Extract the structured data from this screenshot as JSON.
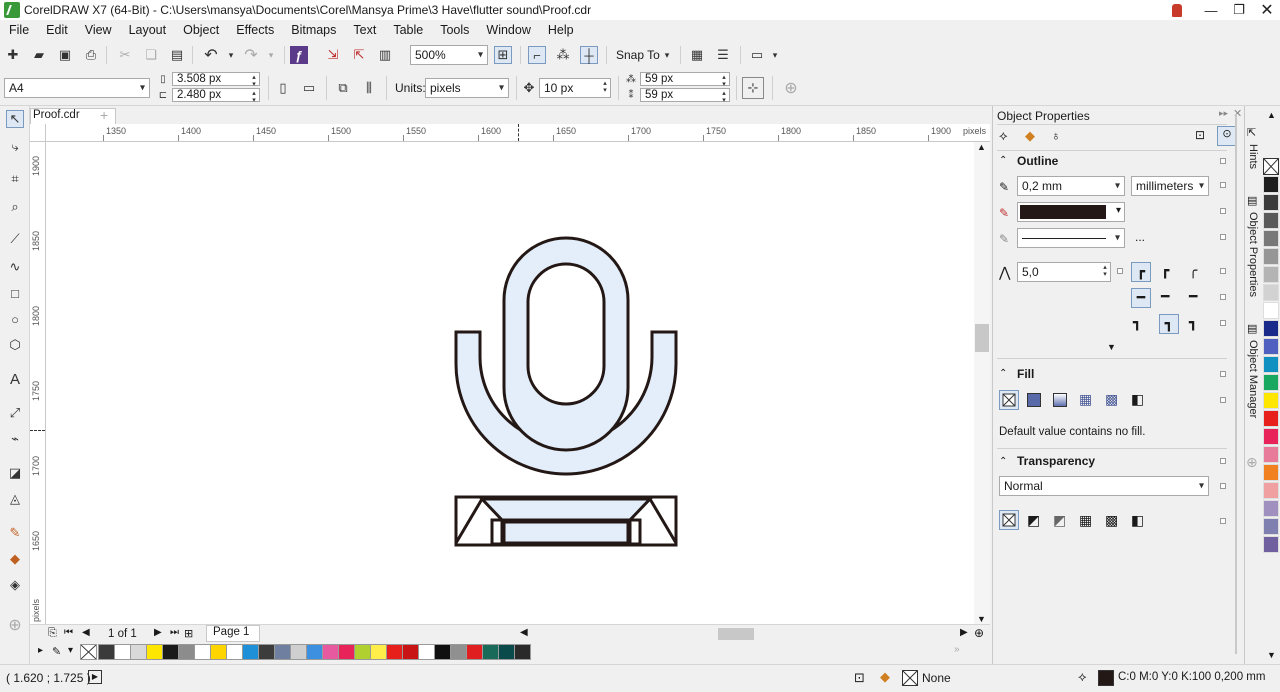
{
  "window": {
    "title": "CorelDRAW X7 (64-Bit) - C:\\Users\\mansya\\Documents\\Corel\\Mansya Prime\\3 Have\\flutter sound\\Proof.cdr"
  },
  "menu": [
    "File",
    "Edit",
    "View",
    "Layout",
    "Object",
    "Effects",
    "Bitmaps",
    "Text",
    "Table",
    "Tools",
    "Window",
    "Help"
  ],
  "toolbar": {
    "zoom": "500%",
    "snap_to": "Snap To"
  },
  "property_bar": {
    "page_size": "A4",
    "width": "3.508 px",
    "height": "2.480 px",
    "units_label": "Units:",
    "units": "pixels",
    "nudge": "10 px",
    "dup_x": "59 px",
    "dup_y": "59 px"
  },
  "document": {
    "tab": "Proof.cdr"
  },
  "rulers": {
    "h_labels": [
      "1350",
      "1400",
      "1450",
      "1500",
      "1550",
      "1600",
      "1650",
      "1700",
      "1750",
      "1800",
      "1850",
      "1900"
    ],
    "h_unit": "pixels",
    "v_labels": [
      "1900",
      "1850",
      "1800",
      "1750",
      "1700",
      "1650"
    ],
    "v_unit": "pixels"
  },
  "page_nav": {
    "count": "1 of 1",
    "page_tab": "Page 1"
  },
  "object_properties": {
    "title": "Object Properties",
    "outline": {
      "header": "Outline",
      "width": "0,2 mm",
      "units": "millimeters",
      "color": "#231815",
      "more": "...",
      "miter": "5,0"
    },
    "fill": {
      "header": "Fill",
      "info": "Default value contains no fill."
    },
    "transparency": {
      "header": "Transparency",
      "mode": "Normal"
    }
  },
  "side_tabs": [
    "Hints",
    "Object Properties",
    "Object Manager"
  ],
  "status": {
    "coords": "( 1.620 ; 1.725 )",
    "fill_label": "None",
    "outline_info": "C:0 M:0 Y:0 K:100  0,200 mm"
  },
  "palette_colors": [
    "#3b3b3b",
    "#ffffff",
    "#d9d9d9",
    "#ffe600",
    "#1a1a1a",
    "#8c8c8c",
    "#ffffff",
    "#ffd500",
    "#ffffff",
    "#1e90d8",
    "#3c3c3c",
    "#6e7fa0",
    "#cfcfcf",
    "#3d8fe0",
    "#e85aa0",
    "#e8235a",
    "#b0d030",
    "#ffed4a",
    "#e8201c",
    "#c81414",
    "#ffffff",
    "#101010",
    "#909090",
    "#e02020",
    "#1a6a5a",
    "#0a4a4a",
    "#2a2a2a"
  ],
  "side_palette": [
    "#1e1e1e",
    "#3c3c3c",
    "#5a5a5a",
    "#787878",
    "#969696",
    "#b4b4b4",
    "#d2d2d2",
    "#ffffff",
    "#1a2a8a",
    "#5060c0",
    "#1090c0",
    "#18a860",
    "#ffe600",
    "#e8201c",
    "#e8235a",
    "#e87a9a",
    "#f08020",
    "#f0a0a0",
    "#a090c0",
    "#8080b0",
    "#7060a0"
  ],
  "drawing": {
    "stroke": "#231815",
    "fill": "#e3eefa"
  }
}
